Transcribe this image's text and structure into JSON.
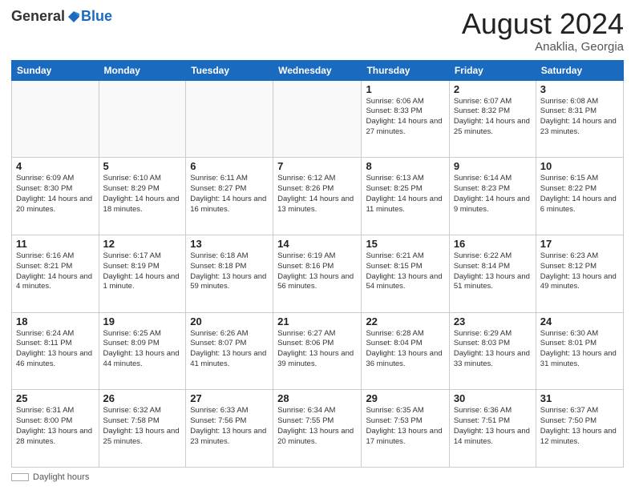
{
  "logo": {
    "general": "General",
    "blue": "Blue"
  },
  "header": {
    "month": "August 2024",
    "location": "Anaklia, Georgia"
  },
  "days_of_week": [
    "Sunday",
    "Monday",
    "Tuesday",
    "Wednesday",
    "Thursday",
    "Friday",
    "Saturday"
  ],
  "weeks": [
    [
      {
        "day": "",
        "info": ""
      },
      {
        "day": "",
        "info": ""
      },
      {
        "day": "",
        "info": ""
      },
      {
        "day": "",
        "info": ""
      },
      {
        "day": "1",
        "info": "Sunrise: 6:06 AM\nSunset: 8:33 PM\nDaylight: 14 hours and 27 minutes."
      },
      {
        "day": "2",
        "info": "Sunrise: 6:07 AM\nSunset: 8:32 PM\nDaylight: 14 hours and 25 minutes."
      },
      {
        "day": "3",
        "info": "Sunrise: 6:08 AM\nSunset: 8:31 PM\nDaylight: 14 hours and 23 minutes."
      }
    ],
    [
      {
        "day": "4",
        "info": "Sunrise: 6:09 AM\nSunset: 8:30 PM\nDaylight: 14 hours and 20 minutes."
      },
      {
        "day": "5",
        "info": "Sunrise: 6:10 AM\nSunset: 8:29 PM\nDaylight: 14 hours and 18 minutes."
      },
      {
        "day": "6",
        "info": "Sunrise: 6:11 AM\nSunset: 8:27 PM\nDaylight: 14 hours and 16 minutes."
      },
      {
        "day": "7",
        "info": "Sunrise: 6:12 AM\nSunset: 8:26 PM\nDaylight: 14 hours and 13 minutes."
      },
      {
        "day": "8",
        "info": "Sunrise: 6:13 AM\nSunset: 8:25 PM\nDaylight: 14 hours and 11 minutes."
      },
      {
        "day": "9",
        "info": "Sunrise: 6:14 AM\nSunset: 8:23 PM\nDaylight: 14 hours and 9 minutes."
      },
      {
        "day": "10",
        "info": "Sunrise: 6:15 AM\nSunset: 8:22 PM\nDaylight: 14 hours and 6 minutes."
      }
    ],
    [
      {
        "day": "11",
        "info": "Sunrise: 6:16 AM\nSunset: 8:21 PM\nDaylight: 14 hours and 4 minutes."
      },
      {
        "day": "12",
        "info": "Sunrise: 6:17 AM\nSunset: 8:19 PM\nDaylight: 14 hours and 1 minute."
      },
      {
        "day": "13",
        "info": "Sunrise: 6:18 AM\nSunset: 8:18 PM\nDaylight: 13 hours and 59 minutes."
      },
      {
        "day": "14",
        "info": "Sunrise: 6:19 AM\nSunset: 8:16 PM\nDaylight: 13 hours and 56 minutes."
      },
      {
        "day": "15",
        "info": "Sunrise: 6:21 AM\nSunset: 8:15 PM\nDaylight: 13 hours and 54 minutes."
      },
      {
        "day": "16",
        "info": "Sunrise: 6:22 AM\nSunset: 8:14 PM\nDaylight: 13 hours and 51 minutes."
      },
      {
        "day": "17",
        "info": "Sunrise: 6:23 AM\nSunset: 8:12 PM\nDaylight: 13 hours and 49 minutes."
      }
    ],
    [
      {
        "day": "18",
        "info": "Sunrise: 6:24 AM\nSunset: 8:11 PM\nDaylight: 13 hours and 46 minutes."
      },
      {
        "day": "19",
        "info": "Sunrise: 6:25 AM\nSunset: 8:09 PM\nDaylight: 13 hours and 44 minutes."
      },
      {
        "day": "20",
        "info": "Sunrise: 6:26 AM\nSunset: 8:07 PM\nDaylight: 13 hours and 41 minutes."
      },
      {
        "day": "21",
        "info": "Sunrise: 6:27 AM\nSunset: 8:06 PM\nDaylight: 13 hours and 39 minutes."
      },
      {
        "day": "22",
        "info": "Sunrise: 6:28 AM\nSunset: 8:04 PM\nDaylight: 13 hours and 36 minutes."
      },
      {
        "day": "23",
        "info": "Sunrise: 6:29 AM\nSunset: 8:03 PM\nDaylight: 13 hours and 33 minutes."
      },
      {
        "day": "24",
        "info": "Sunrise: 6:30 AM\nSunset: 8:01 PM\nDaylight: 13 hours and 31 minutes."
      }
    ],
    [
      {
        "day": "25",
        "info": "Sunrise: 6:31 AM\nSunset: 8:00 PM\nDaylight: 13 hours and 28 minutes."
      },
      {
        "day": "26",
        "info": "Sunrise: 6:32 AM\nSunset: 7:58 PM\nDaylight: 13 hours and 25 minutes."
      },
      {
        "day": "27",
        "info": "Sunrise: 6:33 AM\nSunset: 7:56 PM\nDaylight: 13 hours and 23 minutes."
      },
      {
        "day": "28",
        "info": "Sunrise: 6:34 AM\nSunset: 7:55 PM\nDaylight: 13 hours and 20 minutes."
      },
      {
        "day": "29",
        "info": "Sunrise: 6:35 AM\nSunset: 7:53 PM\nDaylight: 13 hours and 17 minutes."
      },
      {
        "day": "30",
        "info": "Sunrise: 6:36 AM\nSunset: 7:51 PM\nDaylight: 13 hours and 14 minutes."
      },
      {
        "day": "31",
        "info": "Sunrise: 6:37 AM\nSunset: 7:50 PM\nDaylight: 13 hours and 12 minutes."
      }
    ]
  ],
  "footer": {
    "label": "Daylight hours"
  }
}
